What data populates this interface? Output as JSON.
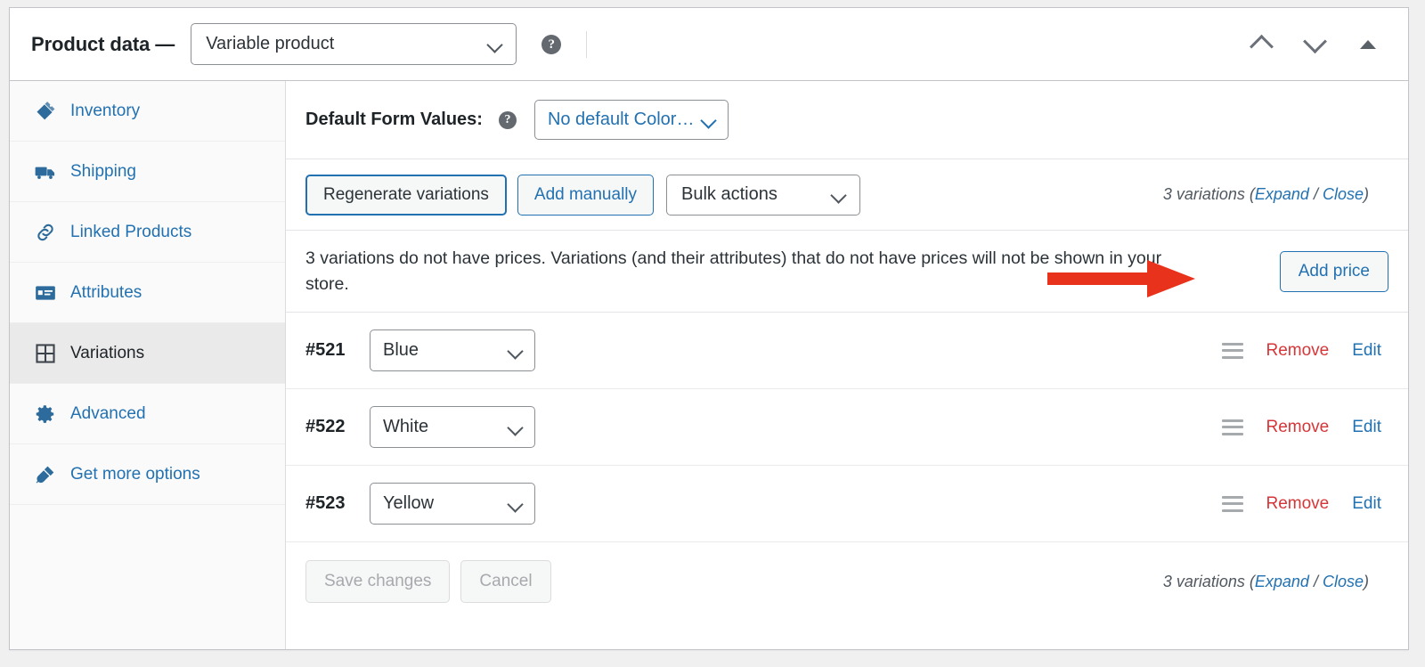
{
  "header": {
    "title": "Product data —",
    "product_type": "Variable product",
    "help_icon": "help-circle-icon",
    "move_up_label": "∧",
    "move_down_label": "∨",
    "toggle_label": "▲"
  },
  "sidebar": {
    "items": [
      {
        "label": "Inventory",
        "icon": "inventory-icon",
        "active": false
      },
      {
        "label": "Shipping",
        "icon": "truck-icon",
        "active": false
      },
      {
        "label": "Linked Products",
        "icon": "link-icon",
        "active": false
      },
      {
        "label": "Attributes",
        "icon": "attributes-icon",
        "active": false
      },
      {
        "label": "Variations",
        "icon": "grid-icon",
        "active": true
      },
      {
        "label": "Advanced",
        "icon": "gear-icon",
        "active": false
      },
      {
        "label": "Get more options",
        "icon": "plug-icon",
        "active": false
      }
    ]
  },
  "default_form_values": {
    "label": "Default Form Values:",
    "help_icon": "help-circle-icon",
    "selected": "No default Color…"
  },
  "toolbar": {
    "regenerate_label": "Regenerate variations",
    "add_manually_label": "Add manually",
    "bulk_actions_label": "Bulk actions"
  },
  "variations_count": {
    "count_text": "3 variations",
    "open_paren": " (",
    "expand_label": "Expand",
    "separator": " / ",
    "close_label": "Close",
    "close_paren": ")"
  },
  "notice": {
    "text": "3 variations do not have prices. Variations (and their attributes) that do not have prices will not be shown in your store.",
    "add_price_label": "Add price",
    "arrow_color": "#e8321c",
    "arrow_name": "red-annotation-arrow"
  },
  "variations": [
    {
      "id": "#521",
      "color": "Blue",
      "remove_label": "Remove",
      "edit_label": "Edit"
    },
    {
      "id": "#522",
      "color": "White",
      "remove_label": "Remove",
      "edit_label": "Edit"
    },
    {
      "id": "#523",
      "color": "Yellow",
      "remove_label": "Remove",
      "edit_label": "Edit"
    }
  ],
  "footer": {
    "save_label": "Save changes",
    "cancel_label": "Cancel"
  },
  "colors": {
    "link_blue": "#2271b1",
    "remove_red": "#d63638",
    "text_dark": "#1d2327",
    "panel_border": "#c3c4c7",
    "sidebar_bg": "#fafafa",
    "active_bg": "#eaeaea",
    "page_bg": "#f0f0f1"
  }
}
